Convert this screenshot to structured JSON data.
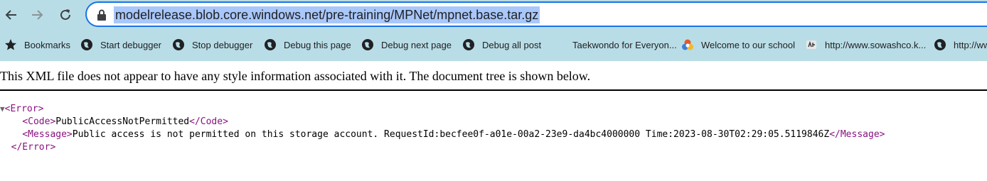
{
  "address_bar": {
    "url": "modelrelease.blob.core.windows.net/pre-training/MPNet/mpnet.base.tar.gz"
  },
  "bookmarks": {
    "items": [
      {
        "label": "Bookmarks",
        "icon": "star-icon"
      },
      {
        "label": "Start debugger",
        "icon": "globe-icon"
      },
      {
        "label": "Stop debugger",
        "icon": "globe-icon"
      },
      {
        "label": "Debug this page",
        "icon": "globe-icon"
      },
      {
        "label": "Debug next page",
        "icon": "globe-icon"
      },
      {
        "label": "Debug all post",
        "icon": "globe-icon"
      },
      {
        "label": "Taekwondo for Everyon...",
        "icon": "none"
      },
      {
        "label": "Welcome to our school",
        "icon": "school-logo-icon"
      },
      {
        "label": "http://www.sowashco.k...",
        "icon": "site-logo-icon"
      },
      {
        "label": "http://ww",
        "icon": "globe-icon"
      }
    ]
  },
  "page": {
    "notice": "This XML file does not appear to have any style information associated with it. The document tree is shown below.",
    "xml": {
      "error_open": "<Error>",
      "code_open": "<Code>",
      "code_value": "PublicAccessNotPermitted",
      "code_close": "</Code>",
      "message_open": "<Message>",
      "message_value": "Public access is not permitted on this storage account. RequestId:becfee0f-a01e-00a2-23e9-da4bc4000000 Time:2023-08-30T02:29:05.5119846Z",
      "message_close": "</Message>",
      "error_close": "</Error>",
      "collapse_marker": "▼"
    }
  },
  "colors": {
    "toolbar_bg": "#b9dde6",
    "omnibox_border": "#1a73e8",
    "url_selection": "#a8c7fa",
    "xml_tag": "#881280"
  }
}
